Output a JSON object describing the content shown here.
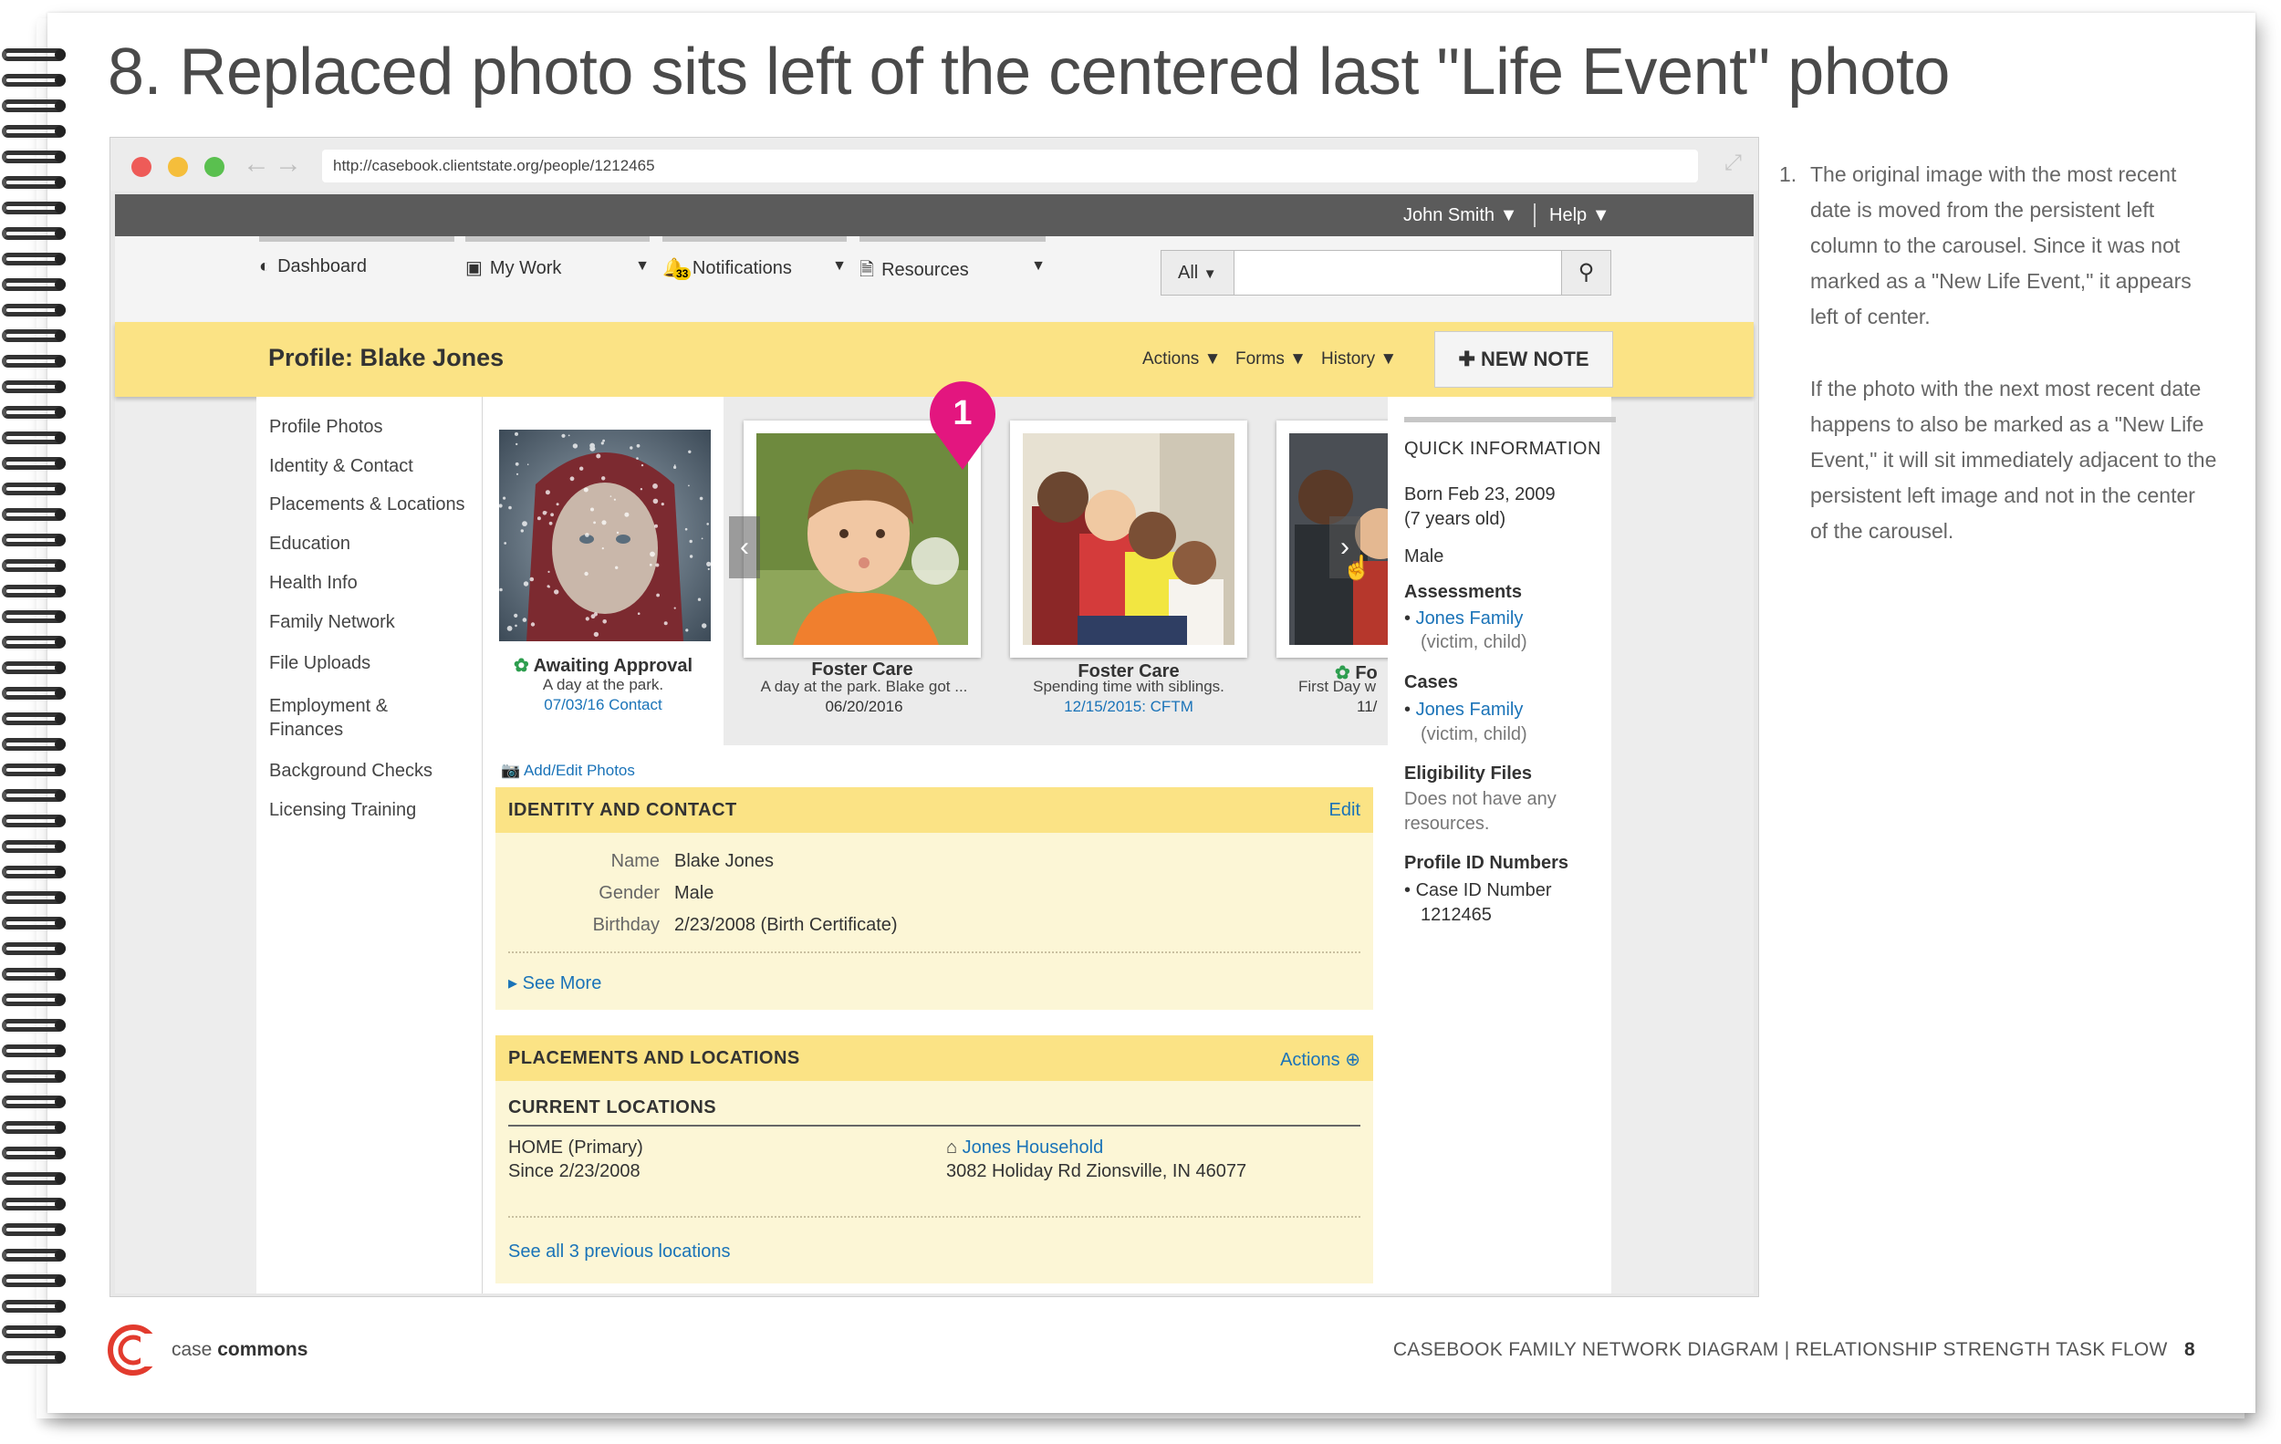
{
  "slide": {
    "title": "8. Replaced photo sits left of the centered last \"Life Event\" photo",
    "page_number": "8",
    "footer_right": "CASEBOOK FAMILY NETWORK DIAGRAM | RELATIONSHIP STRENGTH TASK FLOW",
    "brand_light": "case",
    "brand_bold": "commons"
  },
  "browser": {
    "url": "http://casebook.clientstate.org/people/1212465"
  },
  "topbar": {
    "user": "John Smith",
    "help": "Help"
  },
  "nav": {
    "items": [
      {
        "label": "Dashboard",
        "icon": "dashboard-icon"
      },
      {
        "label": "My Work",
        "icon": "inbox-icon"
      },
      {
        "label": "Notifications",
        "icon": "bell-icon",
        "badge": "33"
      },
      {
        "label": "Resources",
        "icon": "document-icon"
      }
    ],
    "search_scope": "All",
    "search_placeholder": ""
  },
  "profile": {
    "title": "Profile: Blake Jones",
    "menus": [
      "Actions",
      "Forms",
      "History"
    ],
    "new_note": "NEW NOTE"
  },
  "sidebar": {
    "items": [
      "Profile Photos",
      "Identity & Contact",
      "Placements & Locations",
      "Education",
      "Health Info",
      "Family Network",
      "File Uploads",
      "Employment &",
      "Finances",
      "Background Checks",
      "Licensing Training"
    ]
  },
  "carousel": {
    "marker": "1",
    "persistent": {
      "title": "Awaiting Approval",
      "desc": "A day at the park.",
      "link": "07/03/16 Contact"
    },
    "photos": [
      {
        "title": "Foster Care",
        "desc": "A day at the park. Blake got ...",
        "date": "06/20/2016"
      },
      {
        "title": "Foster Care",
        "desc": "Spending time with siblings.",
        "link": "12/15/2015: CFTM"
      },
      {
        "title": "Fo",
        "desc": "First Day w",
        "date": "11/"
      }
    ],
    "add_edit": "Add/Edit Photos"
  },
  "identity": {
    "heading": "IDENTITY AND CONTACT",
    "action": "Edit",
    "rows": [
      {
        "label": "Name",
        "value": "Blake Jones"
      },
      {
        "label": "Gender",
        "value": "Male"
      },
      {
        "label": "Birthday",
        "value": "2/23/2008 (Birth Certificate)"
      }
    ],
    "see_more": "See More"
  },
  "placements": {
    "heading": "PLACEMENTS AND LOCATIONS",
    "action": "Actions",
    "sub_heading": "CURRENT LOCATIONS",
    "location_type": "HOME (Primary)",
    "since": "Since 2/23/2008",
    "household": "Jones Household",
    "address": "3082 Holiday Rd Zionsville, IN 46077",
    "see_all": "See all 3 previous locations"
  },
  "quick_info": {
    "heading": "QUICK INFORMATION",
    "born": "Born Feb 23, 2009",
    "age": "(7 years old)",
    "gender": "Male",
    "assessments_label": "Assessments",
    "assessment_link": "Jones Family",
    "assessment_role": "(victim, child)",
    "cases_label": "Cases",
    "case_link": "Jones Family",
    "case_role": "(victim, child)",
    "eligibility_label": "Eligibility Files",
    "eligibility_text_1": "Does not have any",
    "eligibility_text_2": "resources.",
    "profile_ids_label": "Profile ID Numbers",
    "case_id_label": "Case ID Number",
    "case_id_value": "1212465"
  },
  "notes": {
    "num": "1.",
    "p1": "The original image with the most recent date is moved from the persistent left column to the carousel. Since it was not marked as a \"New Life Event,\" it appears left of center.",
    "p2": "If the photo with the next most recent date happens to also be marked as a \"New Life Event,\" it will sit immediately adjacent to the persistent left image and not in the center of the carousel."
  },
  "colors": {
    "accent_yellow": "#fbe385",
    "panel_bg": "#fcf6d6",
    "link_blue": "#1a73b8",
    "marker_pink": "#e3167f",
    "topbar_gray": "#5b5b5b"
  }
}
